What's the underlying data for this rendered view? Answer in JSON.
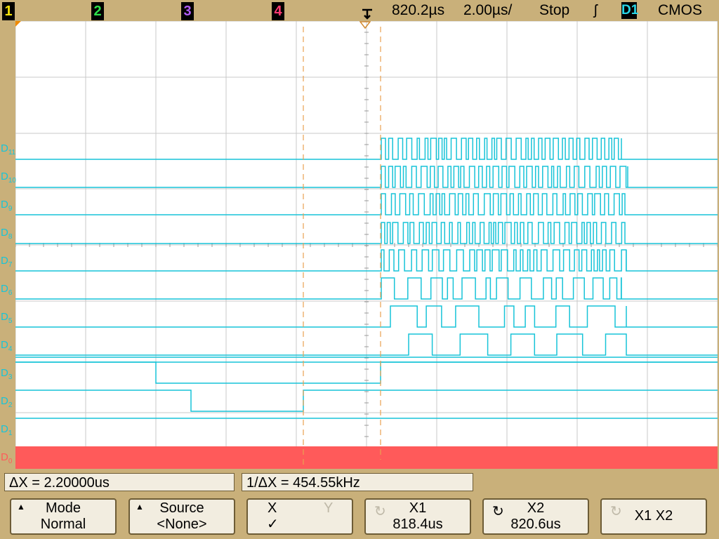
{
  "top": {
    "channels": [
      {
        "label": "1",
        "color": "#f5e20a"
      },
      {
        "label": "2",
        "color": "#2ee04a"
      },
      {
        "label": "3",
        "color": "#b05cf5"
      },
      {
        "label": "4",
        "color": "#ff3a72"
      }
    ],
    "time_position": "820.2µs",
    "time_scale": "2.00µs/",
    "run_state": "Stop",
    "trigger_slope_glyph": "ʃ",
    "trigger_source": "D1",
    "threshold_mode": "CMOS"
  },
  "screen": {
    "digital_labels": [
      {
        "main": "D",
        "sub": "11",
        "color": "#17c4d8"
      },
      {
        "main": "D",
        "sub": "10",
        "color": "#17c4d8"
      },
      {
        "main": "D",
        "sub": "9",
        "color": "#17c4d8"
      },
      {
        "main": "D",
        "sub": "8",
        "color": "#17c4d8"
      },
      {
        "main": "D",
        "sub": "7",
        "color": "#17c4d8"
      },
      {
        "main": "D",
        "sub": "6",
        "color": "#17c4d8"
      },
      {
        "main": "D",
        "sub": "5",
        "color": "#17c4d8"
      },
      {
        "main": "D",
        "sub": "4",
        "color": "#17c4d8"
      },
      {
        "main": "D",
        "sub": "3",
        "color": "#17c4d8"
      },
      {
        "main": "D",
        "sub": "2",
        "color": "#17c4d8"
      },
      {
        "main": "D",
        "sub": "1",
        "color": "#17c4d8"
      },
      {
        "main": "D",
        "sub": "0",
        "color": "#ff5a5a"
      }
    ],
    "colors": {
      "trace": "#17c4d8",
      "d0_fill": "#ff5a5a",
      "cursor": "#e8a050",
      "grid": "#c8c8c8"
    }
  },
  "measurements": {
    "delta_x": "ΔX = 2.20000us",
    "inv_delta_x": "1/ΔX = 454.55kHz"
  },
  "softkeys": {
    "mode": {
      "title": "Mode",
      "value": "Normal"
    },
    "source": {
      "title": "Source",
      "value": "<None>"
    },
    "xy": {
      "x": "X",
      "y": "Y",
      "check": "✓"
    },
    "x1": {
      "title": "X1",
      "value": "818.4us"
    },
    "x2": {
      "title": "X2",
      "value": "820.6us"
    },
    "x1x2": {
      "title": "X1 X2"
    }
  }
}
